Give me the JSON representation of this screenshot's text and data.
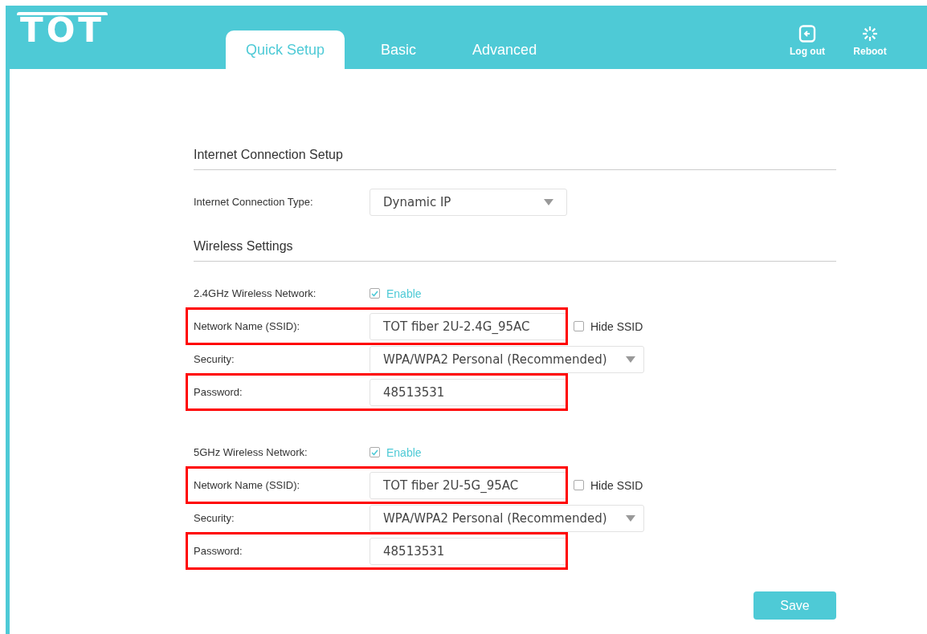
{
  "header": {
    "logo": "TOT",
    "tabs": [
      {
        "label": "Quick Setup",
        "selected": true
      },
      {
        "label": "Basic",
        "selected": false
      },
      {
        "label": "Advanced",
        "selected": false
      }
    ],
    "actions": [
      {
        "kind": "logout",
        "label": "Log out"
      },
      {
        "kind": "reboot",
        "label": "Reboot"
      }
    ]
  },
  "sections": [
    {
      "title": "Internet Connection Setup",
      "rows": [
        {
          "kind": "select",
          "label": "Internet Connection Type:",
          "value": "Dynamic IP",
          "highlighted": false
        }
      ]
    },
    {
      "title": "Wireless Settings",
      "groups": [
        {
          "rows": [
            {
              "kind": "checkbox",
              "label": "2.4GHz Wireless Network:",
              "option": "Enable",
              "checked": true,
              "highlighted": false
            },
            {
              "kind": "text",
              "label": "Network Name (SSID):",
              "value": "TOT fiber 2U-2.4G_95AC",
              "highlighted": true,
              "side_option": "Hide SSID",
              "side_checked": false
            },
            {
              "kind": "wideselect",
              "label": "Security:",
              "value": "WPA/WPA2 Personal (Recommended)",
              "highlighted": false
            },
            {
              "kind": "text",
              "label": "Password:",
              "value": "48513531",
              "highlighted": true
            }
          ]
        },
        {
          "rows": [
            {
              "kind": "checkbox",
              "label": "5GHz Wireless Network:",
              "option": "Enable",
              "checked": true,
              "highlighted": false
            },
            {
              "kind": "text",
              "label": "Network Name (SSID):",
              "value": "TOT fiber 2U-5G_95AC",
              "highlighted": true,
              "side_option": "Hide SSID",
              "side_checked": false
            },
            {
              "kind": "wideselect",
              "label": "Security:",
              "value": "WPA/WPA2 Personal (Recommended)",
              "highlighted": false
            },
            {
              "kind": "text",
              "label": "Password:",
              "value": "48513531",
              "highlighted": true
            }
          ]
        }
      ]
    }
  ],
  "save_button": "Save"
}
